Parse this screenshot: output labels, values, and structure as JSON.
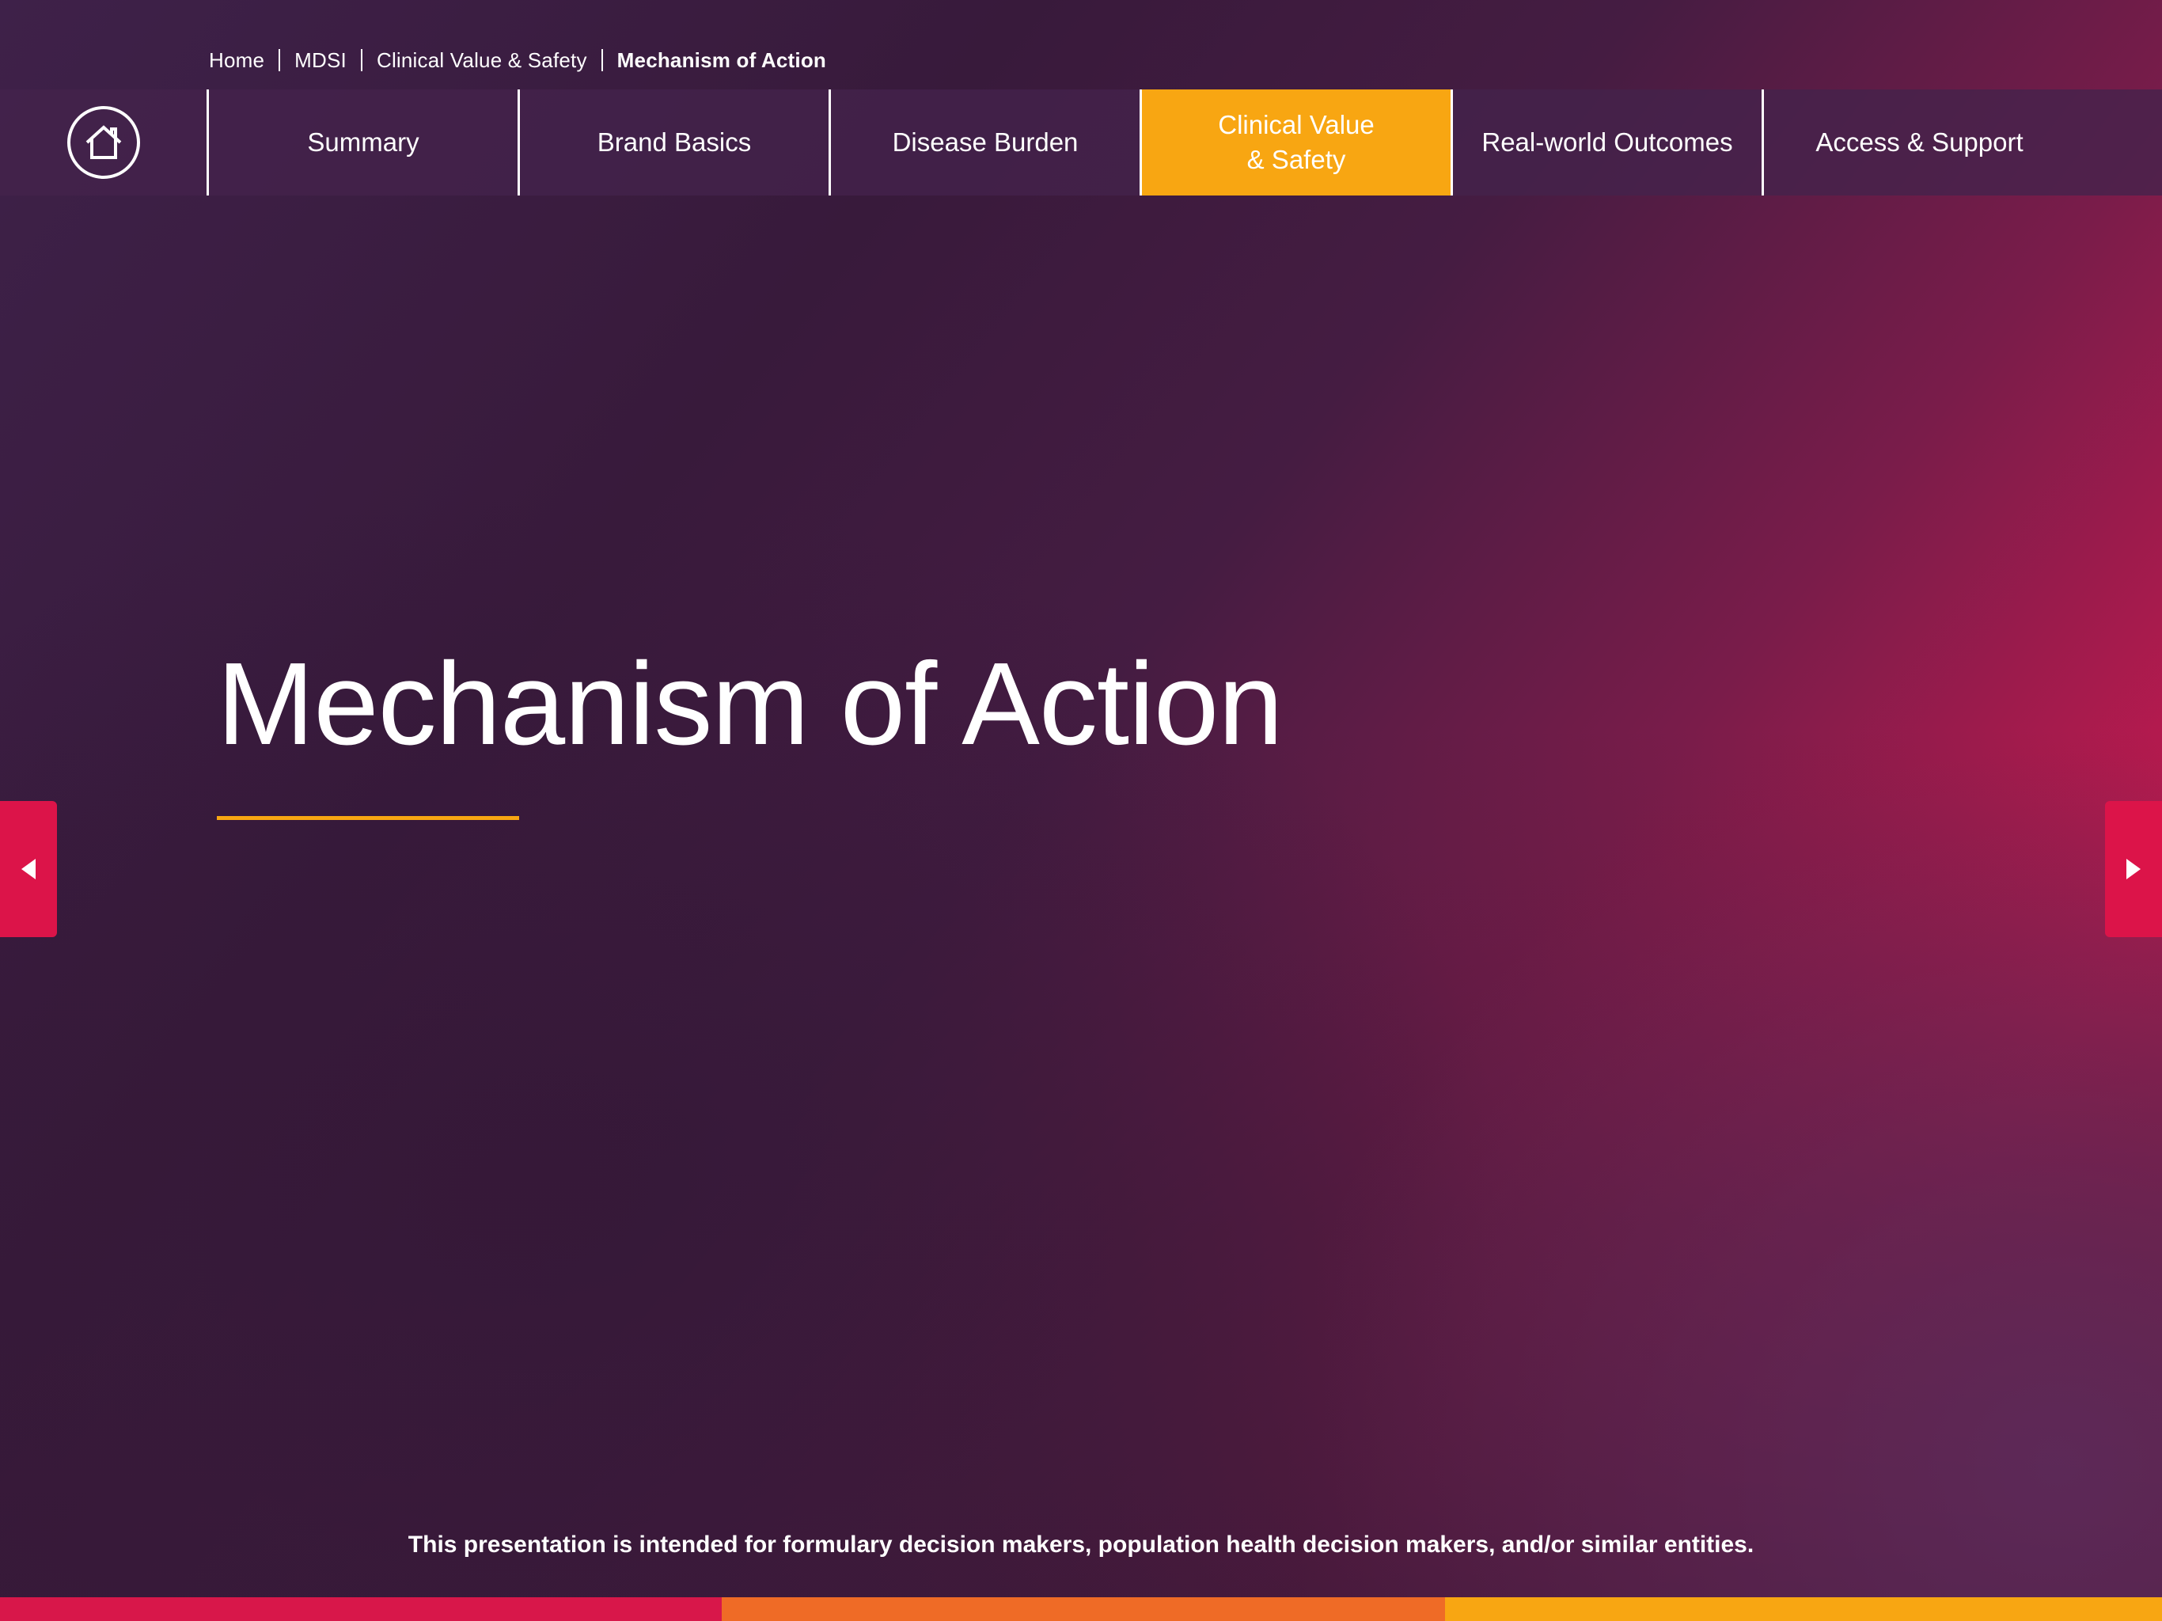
{
  "breadcrumb": {
    "items": [
      "Home",
      "MDSI",
      "Clinical Value & Safety"
    ],
    "current": "Mechanism of Action"
  },
  "nav": {
    "home_icon": "home-icon",
    "tabs": [
      {
        "label": "Summary",
        "active": false
      },
      {
        "label": "Brand Basics",
        "active": false
      },
      {
        "label": "Disease Burden",
        "active": false
      },
      {
        "label": "Clinical Value\n& Safety",
        "active": true
      },
      {
        "label": "Real-world Outcomes",
        "active": false
      },
      {
        "label": "Access & Support",
        "active": false
      }
    ]
  },
  "main": {
    "title": "Mechanism of Action"
  },
  "arrows": {
    "prev_icon": "caret-left-icon",
    "next_icon": "caret-right-icon"
  },
  "footer": {
    "disclaimer": "This presentation is intended for formulary decision makers, population health decision makers, and/or similar entities."
  },
  "colors": {
    "accent_orange": "#f8a612",
    "accent_red": "#dc1449",
    "stripe_orange": "#ef6b26",
    "background_dark": "#361938"
  }
}
